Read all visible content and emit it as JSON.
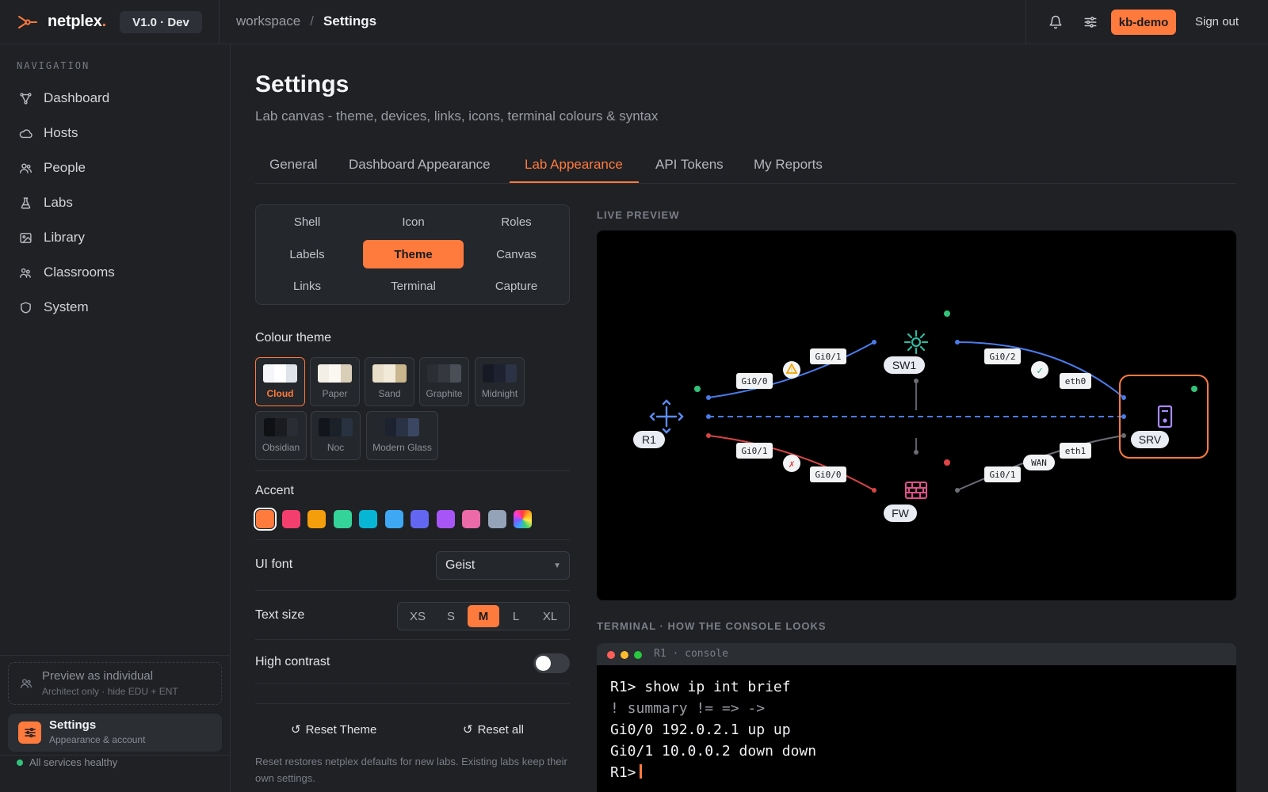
{
  "app": {
    "logo_text": "netplex",
    "logo_dot": ".",
    "version": "V1.0 · Dev"
  },
  "breadcrumb": {
    "root": "workspace",
    "separator": "/",
    "current": "Settings"
  },
  "header": {
    "user": "kb-demo",
    "sign_out": "Sign out",
    "icons": [
      "bell-icon",
      "sliders-icon"
    ]
  },
  "sidebar": {
    "heading": "NAVIGATION",
    "items": [
      {
        "label": "Dashboard",
        "icon": "network-icon"
      },
      {
        "label": "Hosts",
        "icon": "cloud-icon"
      },
      {
        "label": "People",
        "icon": "people-icon"
      },
      {
        "label": "Labs",
        "icon": "flask-icon"
      },
      {
        "label": "Library",
        "icon": "image-icon"
      },
      {
        "label": "Classrooms",
        "icon": "classroom-icon"
      },
      {
        "label": "System",
        "icon": "shield-icon"
      }
    ],
    "preview": {
      "title": "Preview as individual",
      "subtitle": "Architect only · hide EDU + ENT"
    },
    "settings_card": {
      "title": "Settings",
      "subtitle": "Appearance & account"
    },
    "health": "All services healthy"
  },
  "page": {
    "title": "Settings",
    "subtitle": "Lab canvas - theme, devices, links, icons, terminal colours & syntax",
    "tabs": [
      "General",
      "Dashboard Appearance",
      "Lab Appearance",
      "API Tokens",
      "My Reports"
    ],
    "active_tab": "Lab Appearance"
  },
  "subtabs": {
    "items": [
      "Shell",
      "Icon",
      "Roles",
      "Labels",
      "Theme",
      "Canvas",
      "Links",
      "Terminal",
      "Capture"
    ],
    "active": "Theme"
  },
  "colour_theme": {
    "label": "Colour theme",
    "active": "Cloud",
    "themes": [
      {
        "name": "Cloud",
        "colors": [
          "#f4f6f9",
          "#ffffff",
          "#dfe3ea"
        ]
      },
      {
        "name": "Paper",
        "colors": [
          "#f3efe6",
          "#fbf8f1",
          "#d9ceb8"
        ]
      },
      {
        "name": "Sand",
        "colors": [
          "#e9dfc9",
          "#f1ead9",
          "#c9b58e"
        ]
      },
      {
        "name": "Graphite",
        "colors": [
          "#2b2e33",
          "#35383e",
          "#4a4e56"
        ]
      },
      {
        "name": "Midnight",
        "colors": [
          "#171a24",
          "#1e2230",
          "#2d3346"
        ]
      },
      {
        "name": "Obsidian",
        "colors": [
          "#101114",
          "#1a1c20",
          "#2a2d33"
        ]
      },
      {
        "name": "Noc",
        "colors": [
          "#12161c",
          "#1b2129",
          "#293240"
        ]
      },
      {
        "name": "Modern Glass",
        "colors": [
          "#1c2230",
          "#2a3346",
          "#3b4762"
        ]
      }
    ]
  },
  "accent": {
    "label": "Accent",
    "colors": [
      "#ff7a3d",
      "#f43f6e",
      "#f59e0b",
      "#34d399",
      "#06b6d4",
      "#3ea8f5",
      "#6366f1",
      "#a855f7",
      "#ec6aa8",
      "#94a3b8",
      "rainbow"
    ],
    "active": "#ff7a3d"
  },
  "ui_font": {
    "label": "UI font",
    "value": "Geist"
  },
  "text_size": {
    "label": "Text size",
    "options": [
      "XS",
      "S",
      "M",
      "L",
      "XL"
    ],
    "active": "M"
  },
  "high_contrast": {
    "label": "High contrast",
    "enabled": false
  },
  "reset": {
    "theme": "Reset Theme",
    "all": "Reset all",
    "note": "Reset restores netplex defaults for new labs. Existing labs keep their own settings."
  },
  "preview": {
    "label": "LIVE PREVIEW",
    "nodes": {
      "r1": "R1",
      "sw1": "SW1",
      "srv": "SRV",
      "fw": "FW"
    },
    "ports": {
      "r1_sw1_a": "Gi0/0",
      "r1_sw1_b": "Gi0/1",
      "sw1_srv_a": "Gi0/2",
      "sw1_srv_b": "eth0",
      "r1_fw_a": "Gi0/1",
      "r1_fw_b": "Gi0/0",
      "fw_srv_a": "Gi0/1",
      "fw_srv_b": "WAN",
      "fw_srv_c": "eth1"
    },
    "markers": {
      "warn": "!",
      "ok": "✓",
      "err": "✗"
    }
  },
  "terminal": {
    "label": "TERMINAL · HOW THE CONSOLE LOOKS",
    "title": "R1 · console",
    "lines": [
      {
        "text": "R1> show ip int brief",
        "type": "command"
      },
      {
        "text": "! summary != => ->",
        "type": "comment"
      },
      {
        "text": "Gi0/0 192.0.2.1 up up",
        "type": "output"
      },
      {
        "text": "Gi0/1 10.0.0.2 down down",
        "type": "output"
      }
    ],
    "prompt": "R1>"
  }
}
